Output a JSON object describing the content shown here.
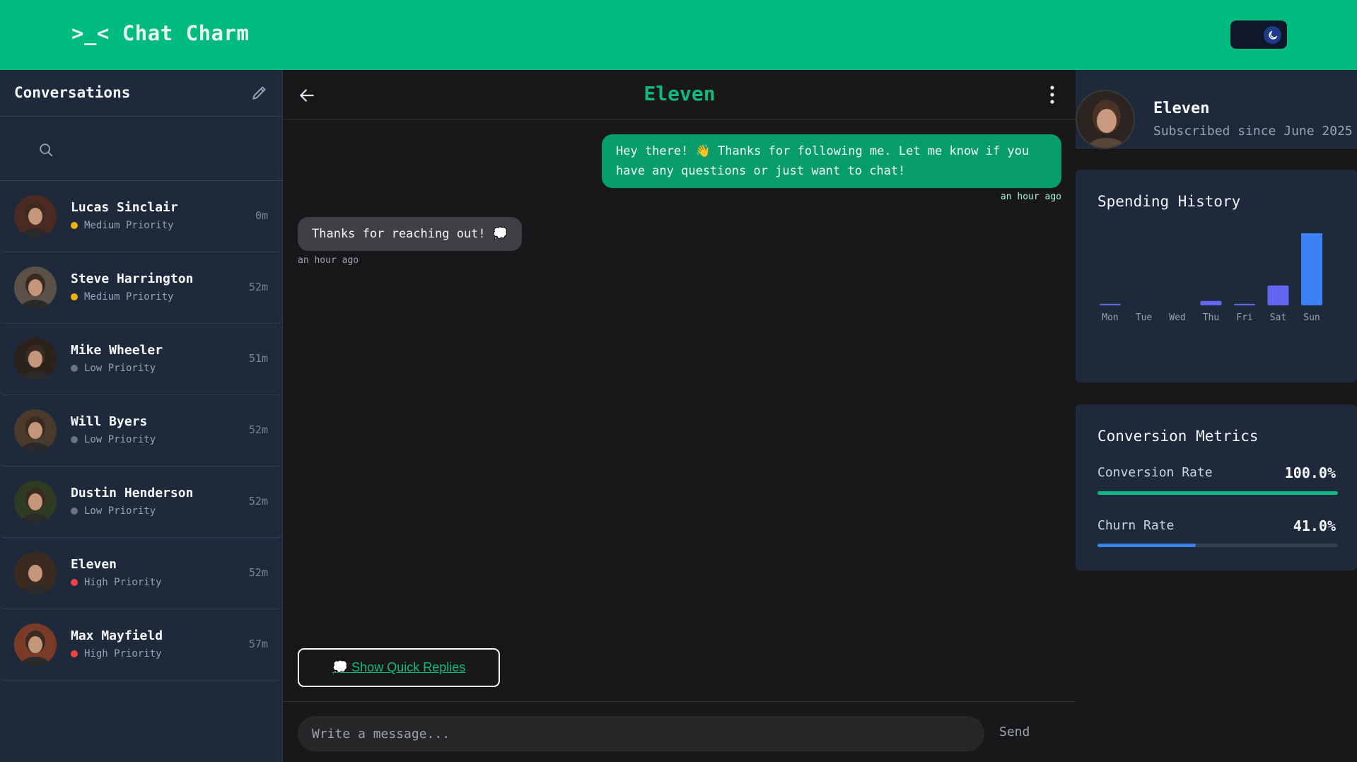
{
  "app": {
    "title": ">_< Chat Charm"
  },
  "theme_toggle": {
    "icon": "moon-icon"
  },
  "sidebar": {
    "title": "Conversations",
    "search": {
      "placeholder": ""
    },
    "conversations": [
      {
        "name": "Lucas Sinclair",
        "priority": "Medium Priority",
        "priority_color": "#eab308",
        "time": "0m",
        "avatar_color": "#4a2a22"
      },
      {
        "name": "Steve Harrington",
        "priority": "Medium Priority",
        "priority_color": "#eab308",
        "time": "52m",
        "avatar_color": "#5b5148"
      },
      {
        "name": "Mike Wheeler",
        "priority": "Low Priority",
        "priority_color": "#6b7280",
        "time": "51m",
        "avatar_color": "#2c221c"
      },
      {
        "name": "Will Byers",
        "priority": "Low Priority",
        "priority_color": "#6b7280",
        "time": "52m",
        "avatar_color": "#4a3a2c"
      },
      {
        "name": "Dustin Henderson",
        "priority": "Low Priority",
        "priority_color": "#6b7280",
        "time": "52m",
        "avatar_color": "#2f3a22"
      },
      {
        "name": "Eleven",
        "priority": "High Priority",
        "priority_color": "#ef4444",
        "time": "52m",
        "avatar_color": "#3a2a20"
      },
      {
        "name": "Max Mayfield",
        "priority": "High Priority",
        "priority_color": "#ef4444",
        "time": "57m",
        "avatar_color": "#7a3a28"
      }
    ]
  },
  "chat": {
    "title": "Eleven",
    "messages": [
      {
        "direction": "outgoing",
        "text": "Hey there! 👋 Thanks for following me. Let me know if you have any questions or just want to chat!",
        "time": "an hour ago"
      },
      {
        "direction": "incoming",
        "text": "Thanks for reaching out! 💭",
        "time": "an hour ago"
      }
    ],
    "quick_replies_label": "💭 Show Quick Replies",
    "input_placeholder": "Write a message...",
    "send_label": "Send"
  },
  "profile": {
    "name": "Eleven",
    "subtitle": "Subscribed since June 2025"
  },
  "spending": {
    "title": "Spending History",
    "chart_data": {
      "type": "bar",
      "categories": [
        "Mon",
        "Tue",
        "Wed",
        "Thu",
        "Fri",
        "Sat",
        "Sun"
      ],
      "values": [
        2,
        0,
        0,
        6,
        2,
        27,
        100
      ],
      "colors": [
        "#6366f1",
        "#6366f1",
        "#6366f1",
        "#6366f1",
        "#6366f1",
        "#6366f1",
        "#3b82f6"
      ],
      "ylim": [
        0,
        100
      ]
    }
  },
  "metrics": {
    "title": "Conversion Metrics",
    "items": [
      {
        "label": "Conversion Rate",
        "value": "100.0%",
        "fraction": 1.0,
        "color": "#10b981"
      },
      {
        "label": "Churn Rate",
        "value": "41.0%",
        "fraction": 0.41,
        "color": "#3b82f6"
      }
    ]
  }
}
